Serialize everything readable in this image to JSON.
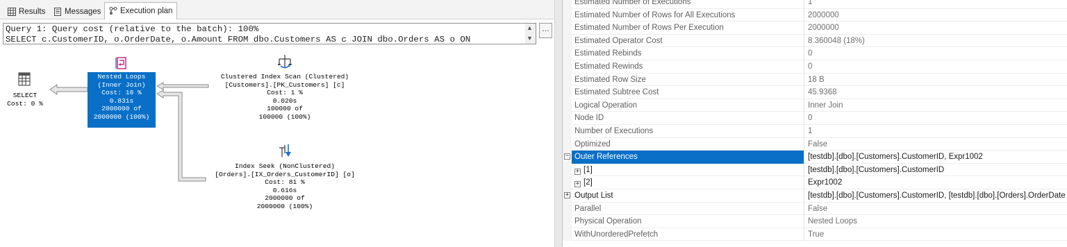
{
  "tabs": [
    {
      "label": "Results",
      "icon": "grid-icon",
      "active": false
    },
    {
      "label": "Messages",
      "icon": "messages-icon",
      "active": false
    },
    {
      "label": "Execution plan",
      "icon": "execution-plan-icon",
      "active": true
    }
  ],
  "query": {
    "line1": "Query 1: Query cost (relative to the batch): 100%",
    "line2": "SELECT c.CustomerID, o.OrderDate, o.Amount FROM dbo.Customers AS c JOIN dbo.Orders AS o ON"
  },
  "plan": {
    "select": {
      "label": "SELECT",
      "cost": "Cost: 0 %"
    },
    "nested_loops": {
      "name": "Nested Loops",
      "subtitle": "(Inner Join)",
      "cost": "Cost: 18 %",
      "time": "0.831s",
      "rows_actual": "2000000 of",
      "rows_estimated": "2000000 (100%)"
    },
    "clustered_scan": {
      "name": "Clustered Index Scan (Clustered)",
      "object": "[Customers].[PK_Customers] [c]",
      "cost": "Cost: 1 %",
      "time": "0.020s",
      "rows_actual": "100000 of",
      "rows_estimated": "100000 (100%)"
    },
    "index_seek": {
      "name": "Index Seek (NonClustered)",
      "object": "[Orders].[IX_Orders_CustomerID] [o]",
      "cost": "Cost: 81 %",
      "time": "0.616s",
      "rows_actual": "2000000 of",
      "rows_estimated": "2000000 (100%)"
    }
  },
  "properties": [
    {
      "name": "Estimated Number of Executions",
      "value": "1",
      "expander": null,
      "editable": false
    },
    {
      "name": "Estimated Number of Rows for All Executions",
      "value": "2000000",
      "expander": null,
      "editable": false
    },
    {
      "name": "Estimated Number of Rows Per Execution",
      "value": "2000000",
      "expander": null,
      "editable": false
    },
    {
      "name": "Estimated Operator Cost",
      "value": "8.360048 (18%)",
      "expander": null,
      "editable": false
    },
    {
      "name": "Estimated Rebinds",
      "value": "0",
      "expander": null,
      "editable": false
    },
    {
      "name": "Estimated Rewinds",
      "value": "0",
      "expander": null,
      "editable": false
    },
    {
      "name": "Estimated Row Size",
      "value": "18 B",
      "expander": null,
      "editable": false
    },
    {
      "name": "Estimated Subtree Cost",
      "value": "45.9368",
      "expander": null,
      "editable": false
    },
    {
      "name": "Logical Operation",
      "value": "Inner Join",
      "expander": null,
      "editable": false
    },
    {
      "name": "Node ID",
      "value": "0",
      "expander": null,
      "editable": false
    },
    {
      "name": "Number of Executions",
      "value": "1",
      "expander": null,
      "editable": false
    },
    {
      "name": "Optimized",
      "value": "False",
      "expander": null,
      "editable": false
    },
    {
      "name": "Outer References",
      "value": "[testdb].[dbo].[Customers].CustomerID, Expr1002",
      "expander": "collapse",
      "editable": true,
      "selected": true
    },
    {
      "name": "[1]",
      "value": "[testdb].[dbo].[Customers].CustomerID",
      "expander": "sub-expand",
      "editable": true
    },
    {
      "name": "[2]",
      "value": "Expr1002",
      "expander": "sub-expand",
      "editable": true
    },
    {
      "name": "Output List",
      "value": "[testdb].[dbo].[Customers].CustomerID, [testdb].[dbo].[Orders].OrderDate",
      "expander": "expand",
      "editable": true
    },
    {
      "name": "Parallel",
      "value": "False",
      "expander": null,
      "editable": false
    },
    {
      "name": "Physical Operation",
      "value": "Nested Loops",
      "expander": null,
      "editable": false
    },
    {
      "name": "WithUnorderedPrefetch",
      "value": "True",
      "expander": null,
      "editable": false
    }
  ],
  "colors": {
    "selection": "#0a6fc7",
    "property_name": "#5e5e5e",
    "property_value_readonly": "#6e6e6e",
    "property_text_editable": "#1a1a1a"
  }
}
